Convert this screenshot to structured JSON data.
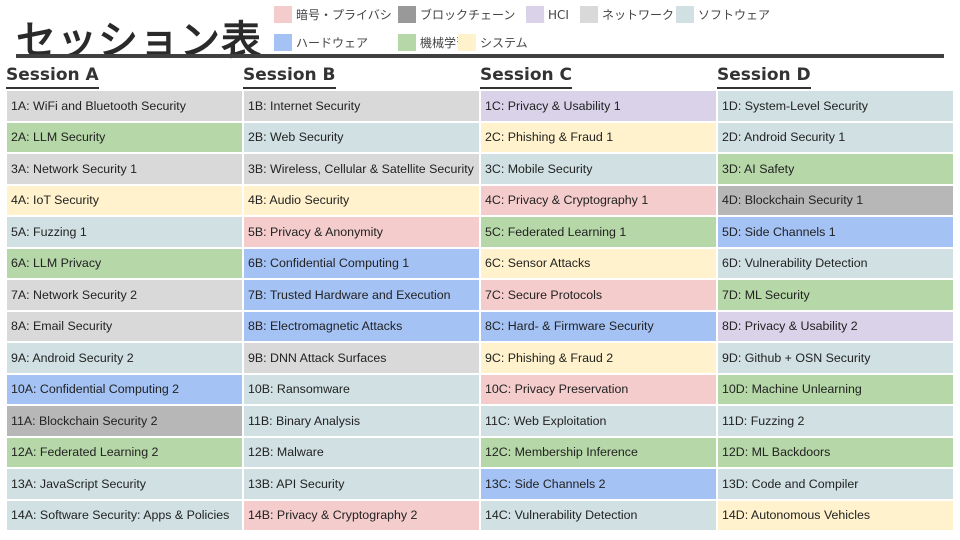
{
  "title": "セッション表",
  "legend": [
    {
      "label": "暗号・プライバシ",
      "color": "#f4cccc"
    },
    {
      "label": "ブロックチェーン",
      "color": "#999999"
    },
    {
      "label": "HCI",
      "color": "#d9d2e9"
    },
    {
      "label": "ネットワーク",
      "color": "#d9d9d9"
    },
    {
      "label": "ソフトウェア",
      "color": "#d0e0e3"
    },
    {
      "label": "ハードウェア",
      "color": "#a4c2f4"
    },
    {
      "label": "機械学習",
      "color": "#b6d7a8"
    },
    {
      "label": "システム",
      "color": "#fff2cc"
    }
  ],
  "sessions": [
    "Session A",
    "Session B",
    "Session C",
    "Session D"
  ],
  "rows": [
    [
      {
        "t": "1A: WiFi and Bluetooth Security",
        "c": "#d9d9d9"
      },
      {
        "t": "1B: Internet Security",
        "c": "#d9d9d9"
      },
      {
        "t": "1C: Privacy & Usability 1",
        "c": "#d9d2e9"
      },
      {
        "t": "1D: System-Level Security",
        "c": "#d0e0e3"
      }
    ],
    [
      {
        "t": "2A: LLM Security",
        "c": "#b6d7a8"
      },
      {
        "t": "2B: Web Security",
        "c": "#d0e0e3"
      },
      {
        "t": "2C: Phishing & Fraud 1",
        "c": "#fff2cc"
      },
      {
        "t": "2D: Android Security 1",
        "c": "#d0e0e3"
      }
    ],
    [
      {
        "t": "3A: Network Security 1",
        "c": "#d9d9d9"
      },
      {
        "t": "3B: Wireless, Cellular & Satellite Security",
        "c": "#d9d9d9"
      },
      {
        "t": "3C: Mobile Security",
        "c": "#d0e0e3"
      },
      {
        "t": "3D: AI Safety",
        "c": "#b6d7a8"
      }
    ],
    [
      {
        "t": "4A: IoT Security",
        "c": "#fff2cc"
      },
      {
        "t": "4B: Audio Security",
        "c": "#fff2cc"
      },
      {
        "t": "4C: Privacy & Cryptography 1",
        "c": "#f4cccc"
      },
      {
        "t": "4D: Blockchain Security 1",
        "c": "#b7b7b7"
      }
    ],
    [
      {
        "t": "5A: Fuzzing 1",
        "c": "#d0e0e3"
      },
      {
        "t": "5B: Privacy & Anonymity",
        "c": "#f4cccc"
      },
      {
        "t": "5C: Federated Learning 1",
        "c": "#b6d7a8"
      },
      {
        "t": "5D: Side Channels 1",
        "c": "#a4c2f4"
      }
    ],
    [
      {
        "t": "6A: LLM Privacy",
        "c": "#b6d7a8"
      },
      {
        "t": "6B: Confidential Computing 1",
        "c": "#a4c2f4"
      },
      {
        "t": "6C: Sensor Attacks",
        "c": "#fff2cc"
      },
      {
        "t": "6D: Vulnerability Detection",
        "c": "#d0e0e3"
      }
    ],
    [
      {
        "t": "7A: Network Security 2",
        "c": "#d9d9d9"
      },
      {
        "t": "7B: Trusted Hardware and Execution",
        "c": "#a4c2f4"
      },
      {
        "t": "7C: Secure Protocols",
        "c": "#f4cccc"
      },
      {
        "t": "7D: ML Security",
        "c": "#b6d7a8"
      }
    ],
    [
      {
        "t": "8A: Email Security",
        "c": "#d9d9d9"
      },
      {
        "t": "8B: Electromagnetic Attacks",
        "c": "#a4c2f4"
      },
      {
        "t": "8C: Hard- & Firmware Security",
        "c": "#a4c2f4"
      },
      {
        "t": "8D: Privacy & Usability 2",
        "c": "#d9d2e9"
      }
    ],
    [
      {
        "t": "9A: Android Security 2",
        "c": "#d0e0e3"
      },
      {
        "t": "9B: DNN Attack Surfaces",
        "c": "#d9d9d9"
      },
      {
        "t": "9C: Phishing & Fraud 2",
        "c": "#fff2cc"
      },
      {
        "t": "9D: Github + OSN Security",
        "c": "#d0e0e3"
      }
    ],
    [
      {
        "t": "10A: Confidential Computing 2",
        "c": "#a4c2f4"
      },
      {
        "t": "10B: Ransomware",
        "c": "#d0e0e3"
      },
      {
        "t": "10C: Privacy Preservation",
        "c": "#f4cccc"
      },
      {
        "t": "10D: Machine Unlearning",
        "c": "#b6d7a8"
      }
    ],
    [
      {
        "t": "11A: Blockchain Security 2",
        "c": "#b7b7b7"
      },
      {
        "t": "11B: Binary Analysis",
        "c": "#d0e0e3"
      },
      {
        "t": "11C: Web Exploitation",
        "c": "#d0e0e3"
      },
      {
        "t": "11D: Fuzzing 2",
        "c": "#d0e0e3"
      }
    ],
    [
      {
        "t": "12A: Federated Learning 2",
        "c": "#b6d7a8"
      },
      {
        "t": "12B: Malware",
        "c": "#d0e0e3"
      },
      {
        "t": "12C: Membership Inference",
        "c": "#b6d7a8"
      },
      {
        "t": "12D: ML Backdoors",
        "c": "#b6d7a8"
      }
    ],
    [
      {
        "t": "13A: JavaScript Security",
        "c": "#d0e0e3"
      },
      {
        "t": "13B: API Security",
        "c": "#d0e0e3"
      },
      {
        "t": "13C: Side Channels 2",
        "c": "#a4c2f4"
      },
      {
        "t": "13D: Code and Compiler",
        "c": "#d0e0e3"
      }
    ],
    [
      {
        "t": "14A: Software Security: Apps & Policies",
        "c": "#d0e0e3"
      },
      {
        "t": "14B: Privacy & Cryptography 2",
        "c": "#f4cccc"
      },
      {
        "t": "14C: Vulnerability Detection",
        "c": "#d0e0e3"
      },
      {
        "t": "14D: Autonomous Vehicles",
        "c": "#fff2cc"
      }
    ]
  ]
}
